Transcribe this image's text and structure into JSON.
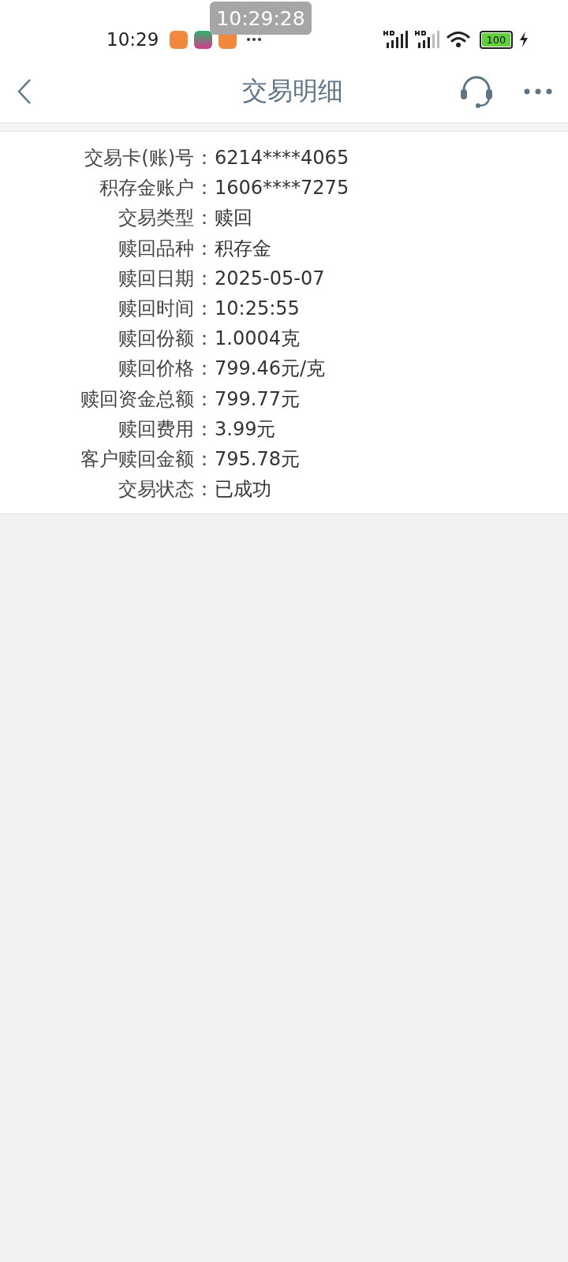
{
  "status_bar": {
    "time": "10:29",
    "overlay_time": "10:29:28",
    "battery": "100"
  },
  "header": {
    "title": "交易明细"
  },
  "details": [
    {
      "label": "交易卡(账)号",
      "value": "6214****4065"
    },
    {
      "label": "积存金账户",
      "value": "1606****7275"
    },
    {
      "label": "交易类型",
      "value": "赎回"
    },
    {
      "label": "赎回品种",
      "value": "积存金"
    },
    {
      "label": "赎回日期",
      "value": "2025-05-07"
    },
    {
      "label": "赎回时间",
      "value": "10:25:55"
    },
    {
      "label": "赎回份额",
      "value": "1.0004克"
    },
    {
      "label": "赎回价格",
      "value": "799.46元/克"
    },
    {
      "label": "赎回资金总额",
      "value": "799.77元"
    },
    {
      "label": "赎回费用",
      "value": "3.99元"
    },
    {
      "label": "客户赎回金额",
      "value": "795.78元"
    },
    {
      "label": "交易状态",
      "value": "已成功"
    }
  ],
  "separator": "："
}
